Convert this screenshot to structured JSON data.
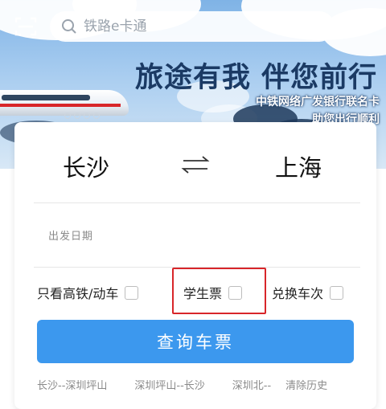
{
  "search": {
    "placeholder": "铁路e卡通"
  },
  "banner": {
    "slogan": "旅途有我 伴您前行",
    "line1": "中铁网络广发银行联名卡",
    "line2": "助您出行顺利"
  },
  "card": {
    "from_station": "长沙",
    "to_station": "上海",
    "date_label": "出发日期",
    "options": [
      {
        "label": "只看高铁/动车",
        "checked": false
      },
      {
        "label": "学生票",
        "checked": false
      },
      {
        "label": "兑换车次",
        "checked": false
      }
    ],
    "query_button": "查询车票",
    "history": [
      "长沙--深圳坪山",
      "深圳坪山--长沙",
      "深圳北--"
    ],
    "clear_history": "清除历史"
  },
  "colors": {
    "accent": "#3c98ee",
    "highlight": "#d8262a",
    "slogan": "#1b3a64"
  }
}
